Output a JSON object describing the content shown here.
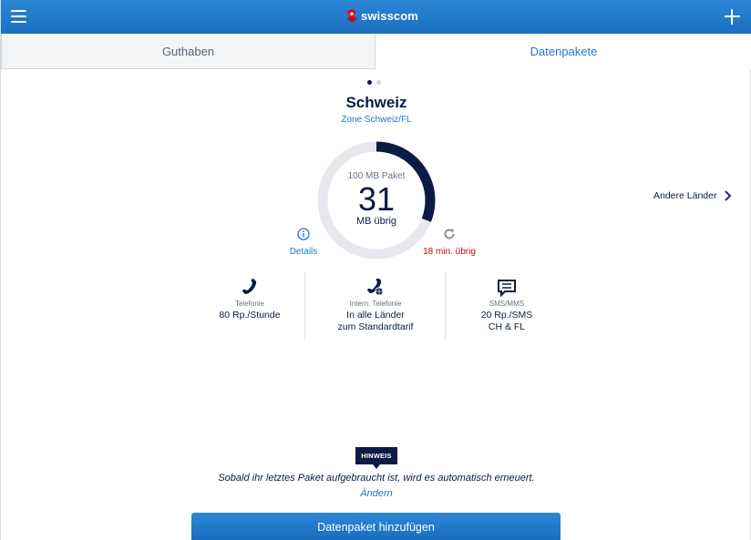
{
  "header": {
    "brand": "swisscom",
    "menu_icon": "hamburger-menu-icon",
    "add_icon": "plus-icon"
  },
  "tabs": [
    {
      "label": "Guthaben",
      "active": false
    },
    {
      "label": "Datenpakete",
      "active": true
    }
  ],
  "pager": {
    "count": 2,
    "active_index": 0
  },
  "package": {
    "country": "Schweiz",
    "zone": "Zone Schweiz/FL",
    "package_label": "100 MB Paket",
    "remaining_value": "31",
    "remaining_unit": "MB übrig",
    "remaining_fraction": 0.31,
    "details_label": "Details",
    "renew_label": "18 min. übrig",
    "other_countries_label": "Andere Länder"
  },
  "tariffs": [
    {
      "icon": "phone-icon",
      "name": "Telefonie",
      "value_lines": [
        "80 Rp./Stunde"
      ]
    },
    {
      "icon": "international-phone-icon",
      "name": "Intern. Telefonie",
      "value_lines": [
        "In alle Länder",
        "zum Standardtarif"
      ]
    },
    {
      "icon": "sms-message-icon",
      "name": "SMS/MMS",
      "value_lines": [
        "20 Rp./SMS",
        "CH & FL"
      ]
    }
  ],
  "hint": {
    "badge": "HINWEIS",
    "text": "Sobald ihr letztes Paket aufgebraucht ist, wird es automatisch erneuert.",
    "link": "Ändern"
  },
  "add_button_label": "Datenpaket hinzufügen",
  "colors": {
    "brand_blue": "#1c6fc0",
    "navy": "#0b1b44",
    "link_blue": "#2377c8",
    "warning_red": "#c00d0d",
    "ring_track": "#e6e8ee"
  }
}
